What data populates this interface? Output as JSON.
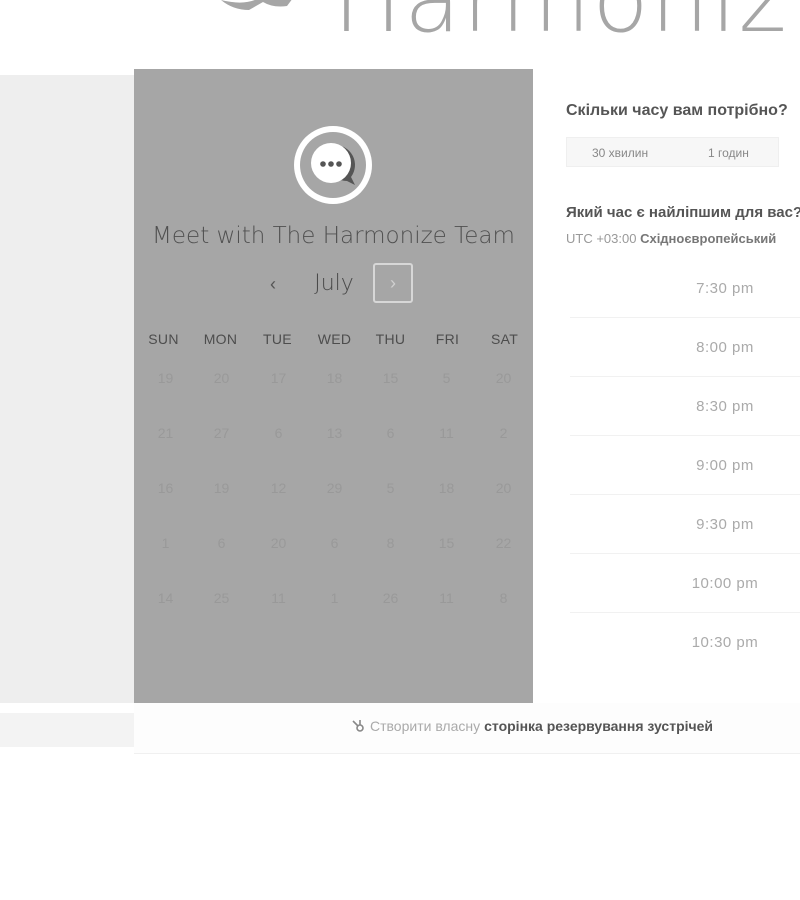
{
  "brand": {
    "name": "Harmoniz"
  },
  "calendar": {
    "title": "Meet with The Harmonize Team",
    "month": "July",
    "prev_icon": "‹",
    "next_icon": "›",
    "weekdays": [
      "SUN",
      "MON",
      "TUE",
      "WED",
      "THU",
      "FRI",
      "SAT"
    ],
    "weeks": [
      [
        "19",
        "20",
        "17",
        "18",
        "15",
        "5",
        "20"
      ],
      [
        "21",
        "27",
        "6",
        "13",
        "6",
        "11",
        "2"
      ],
      [
        "16",
        "19",
        "12",
        "29",
        "5",
        "18",
        "20"
      ],
      [
        "1",
        "6",
        "20",
        "6",
        "8",
        "15",
        "22"
      ],
      [
        "14",
        "25",
        "11",
        "1",
        "26",
        "11",
        "8"
      ]
    ]
  },
  "booking": {
    "duration_question": "Скільки часу вам потрібно?",
    "duration_options": [
      "30 хвилин",
      "1 годин"
    ],
    "time_question": "Який час є найліпшим для вас?",
    "timezone_offset": "UTC +03:00",
    "timezone_name": "Східноєвропейський",
    "time_slots": [
      "7:30 pm",
      "8:00 pm",
      "8:30 pm",
      "9:00 pm",
      "9:30 pm",
      "10:00 pm",
      "10:30 pm"
    ]
  },
  "footer": {
    "prefix": "Створити власну",
    "link": "сторінка резервування зустрічей"
  },
  "colors": {
    "calendar_bg": "#a6a6a6",
    "left_strip": "#eeeeee"
  }
}
